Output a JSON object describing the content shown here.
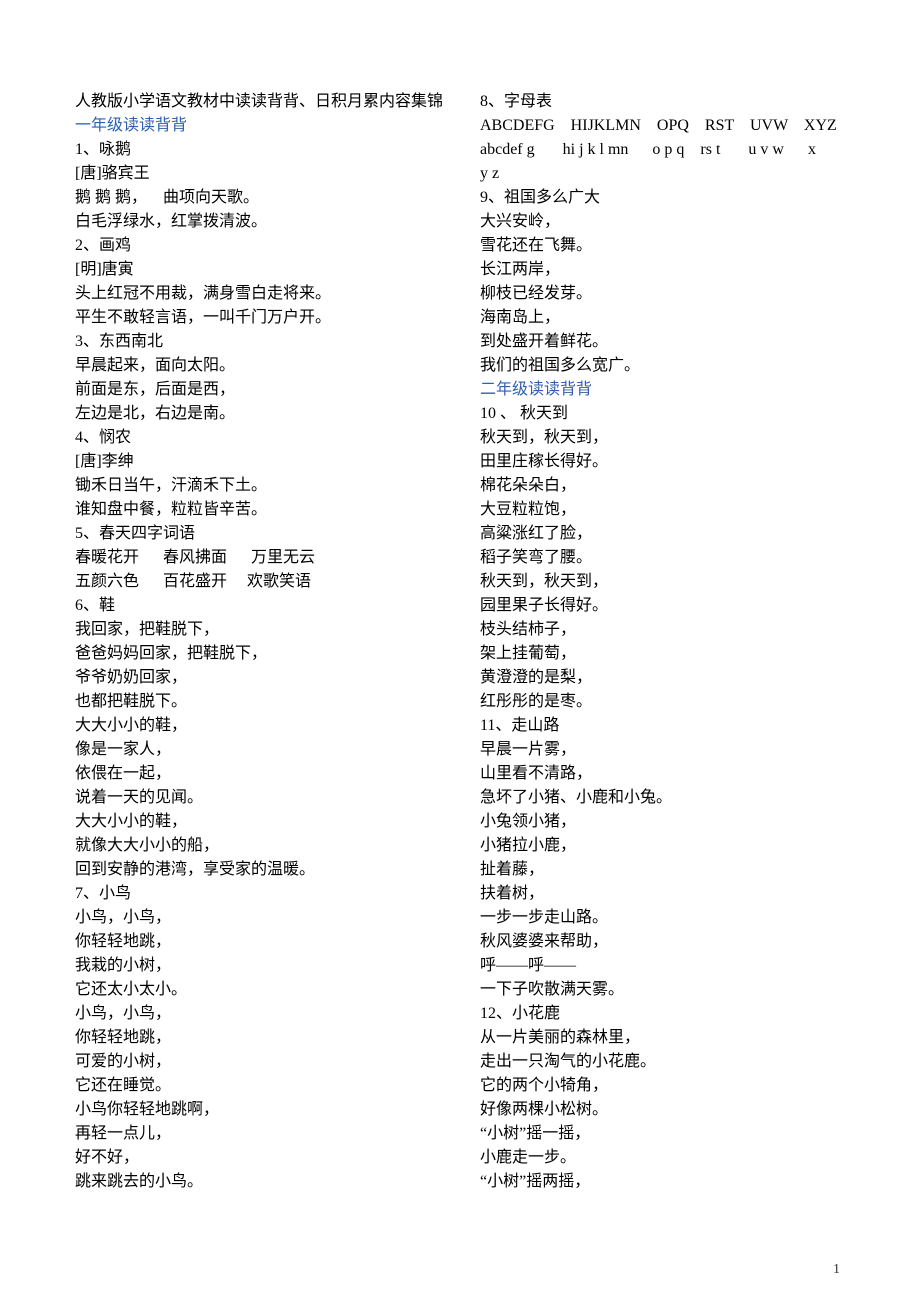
{
  "pageNumber": "1",
  "lines": [
    {
      "text": "人教版小学语文教材中读读背背、日积月累内容集锦",
      "cls": ""
    },
    {
      "text": "一年级读读背背",
      "cls": "blue"
    },
    {
      "text": "1、咏鹅",
      "cls": ""
    },
    {
      "text": "[唐]骆宾王",
      "cls": ""
    },
    {
      "text": "鹅 鹅 鹅，    曲项向天歌。",
      "cls": ""
    },
    {
      "text": "白毛浮绿水，红掌拨清波。",
      "cls": ""
    },
    {
      "text": "2、画鸡",
      "cls": ""
    },
    {
      "text": "[明]唐寅",
      "cls": ""
    },
    {
      "text": "头上红冠不用裁，满身雪白走将来。",
      "cls": ""
    },
    {
      "text": "平生不敢轻言语，一叫千门万户开。",
      "cls": ""
    },
    {
      "text": "3、东西南北",
      "cls": ""
    },
    {
      "text": "早晨起来，面向太阳。",
      "cls": ""
    },
    {
      "text": "前面是东，后面是西，",
      "cls": ""
    },
    {
      "text": "左边是北，右边是南。",
      "cls": ""
    },
    {
      "text": "4、悯农",
      "cls": ""
    },
    {
      "text": "[唐]李绅",
      "cls": ""
    },
    {
      "text": "锄禾日当午，汗滴禾下土。",
      "cls": ""
    },
    {
      "text": "谁知盘中餐，粒粒皆辛苦。",
      "cls": ""
    },
    {
      "text": "5、春天四字词语",
      "cls": ""
    },
    {
      "text": "春暖花开      春风拂面      万里无云",
      "cls": ""
    },
    {
      "text": "五颜六色      百花盛开     欢歌笑语",
      "cls": ""
    },
    {
      "text": "6、鞋",
      "cls": ""
    },
    {
      "text": "我回家，把鞋脱下，",
      "cls": ""
    },
    {
      "text": "爸爸妈妈回家，把鞋脱下，",
      "cls": ""
    },
    {
      "text": "爷爷奶奶回家，",
      "cls": ""
    },
    {
      "text": "也都把鞋脱下。",
      "cls": ""
    },
    {
      "text": "大大小小的鞋，",
      "cls": ""
    },
    {
      "text": "像是一家人，",
      "cls": ""
    },
    {
      "text": "依偎在一起，",
      "cls": ""
    },
    {
      "text": "说着一天的见闻。",
      "cls": ""
    },
    {
      "text": "大大小小的鞋，",
      "cls": ""
    },
    {
      "text": "就像大大小小的船，",
      "cls": ""
    },
    {
      "text": "回到安静的港湾，享受家的温暖。",
      "cls": ""
    },
    {
      "text": "7、小鸟",
      "cls": ""
    },
    {
      "text": "小鸟，小鸟，",
      "cls": ""
    },
    {
      "text": "你轻轻地跳，",
      "cls": ""
    },
    {
      "text": "我栽的小树，",
      "cls": ""
    },
    {
      "text": "它还太小太小。",
      "cls": ""
    },
    {
      "text": "小鸟，小鸟，",
      "cls": ""
    },
    {
      "text": "你轻轻地跳，",
      "cls": ""
    },
    {
      "text": "可爱的小树，",
      "cls": ""
    },
    {
      "text": "它还在睡觉。",
      "cls": ""
    },
    {
      "text": "小鸟你轻轻地跳啊，",
      "cls": ""
    },
    {
      "text": "再轻一点儿，",
      "cls": ""
    },
    {
      "text": "好不好，",
      "cls": ""
    },
    {
      "text": "跳来跳去的小鸟。",
      "cls": ""
    },
    {
      "text": "8、字母表",
      "cls": ""
    },
    {
      "text": "ABCDEFG    HIJKLMN    OPQ    RST    UVW    XYZ",
      "cls": ""
    },
    {
      "text": "abcdef g       hi j k l mn      o p q    rs t       u v w      x",
      "cls": ""
    },
    {
      "text": "y z",
      "cls": ""
    },
    {
      "text": "9、祖国多么广大",
      "cls": ""
    },
    {
      "text": "大兴安岭，",
      "cls": ""
    },
    {
      "text": "雪花还在飞舞。",
      "cls": ""
    },
    {
      "text": "长江两岸，",
      "cls": ""
    },
    {
      "text": "柳枝已经发芽。",
      "cls": ""
    },
    {
      "text": "海南岛上，",
      "cls": ""
    },
    {
      "text": "到处盛开着鲜花。",
      "cls": ""
    },
    {
      "text": "我们的祖国多么宽广。",
      "cls": ""
    },
    {
      "text": "二年级读读背背",
      "cls": "blue"
    },
    {
      "text": "10 、 秋天到",
      "cls": ""
    },
    {
      "text": "秋天到，秋天到，",
      "cls": ""
    },
    {
      "text": "田里庄稼长得好。",
      "cls": ""
    },
    {
      "text": "棉花朵朵白，",
      "cls": ""
    },
    {
      "text": "大豆粒粒饱，",
      "cls": ""
    },
    {
      "text": "高粱涨红了脸，",
      "cls": ""
    },
    {
      "text": "稻子笑弯了腰。",
      "cls": ""
    },
    {
      "text": "秋天到，秋天到，",
      "cls": ""
    },
    {
      "text": "园里果子长得好。",
      "cls": ""
    },
    {
      "text": "枝头结柿子，",
      "cls": ""
    },
    {
      "text": "架上挂葡萄，",
      "cls": ""
    },
    {
      "text": "黄澄澄的是梨，",
      "cls": ""
    },
    {
      "text": "红彤彤的是枣。",
      "cls": ""
    },
    {
      "text": "11、走山路",
      "cls": ""
    },
    {
      "text": "早晨一片雾，",
      "cls": ""
    },
    {
      "text": "山里看不清路，",
      "cls": ""
    },
    {
      "text": "急坏了小猪、小鹿和小兔。",
      "cls": ""
    },
    {
      "text": "小兔领小猪，",
      "cls": ""
    },
    {
      "text": "小猪拉小鹿，",
      "cls": ""
    },
    {
      "text": "扯着藤，",
      "cls": ""
    },
    {
      "text": "扶着树，",
      "cls": ""
    },
    {
      "text": "一步一步走山路。",
      "cls": ""
    },
    {
      "text": "秋风婆婆来帮助，",
      "cls": ""
    },
    {
      "text": "呼——呼——",
      "cls": ""
    },
    {
      "text": "一下子吹散满天雾。",
      "cls": ""
    },
    {
      "text": "12、小花鹿",
      "cls": ""
    },
    {
      "text": "从一片美丽的森林里，",
      "cls": ""
    },
    {
      "text": "走出一只淘气的小花鹿。",
      "cls": ""
    },
    {
      "text": "它的两个小犄角，",
      "cls": ""
    },
    {
      "text": "好像两棵小松树。",
      "cls": ""
    },
    {
      "text": "“小树”摇一摇，",
      "cls": ""
    },
    {
      "text": "小鹿走一步。",
      "cls": ""
    },
    {
      "text": "“小树”摇两摇，",
      "cls": ""
    }
  ]
}
